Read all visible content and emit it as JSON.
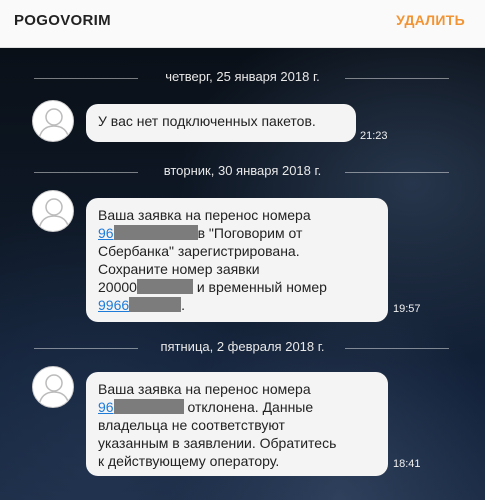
{
  "header": {
    "title": "POGOVORIM",
    "delete_label": "УДАЛИТЬ"
  },
  "messages": [
    {
      "date": "четверг, 25 января 2018 г.",
      "lines": [
        "У вас нет подключенных пакетов."
      ],
      "time": "21:23"
    },
    {
      "date": "вторник, 30 января 2018 г.",
      "number_prefix": "96",
      "line1": "Ваша заявка на перенос номера",
      "line2_suffix": "в \"Поговорим от",
      "line3": "Сбербанка\" зарегистрирована.",
      "line4": "Сохраните номер заявки",
      "request_prefix": "20000",
      "line5_suffix": " и временный номер",
      "temp_prefix": "9966",
      "line6_suffix": ".",
      "time": "19:57"
    },
    {
      "date": "пятница, 2 февраля 2018 г.",
      "line1": "Ваша заявка на перенос номера",
      "number_prefix": "96",
      "line2_suffix": " отклонена. Данные",
      "line3": "владельца не соответствуют",
      "line4": "указанным в заявлении. Обратитесь",
      "line5": "к действующему оператору.",
      "time": "18:41"
    }
  ],
  "colors": {
    "accent": "#f29433",
    "link": "#1e7bd8"
  },
  "icons": {
    "avatar": "person-silhouette-icon"
  }
}
